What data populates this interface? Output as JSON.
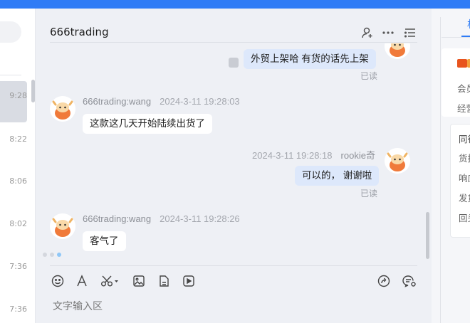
{
  "chat": {
    "title": "666trading",
    "header_icons": [
      "add-user-icon",
      "more-icon",
      "list-icon"
    ],
    "messages": [
      {
        "side": "out",
        "text": "外贸上架哈  有货的话先上架",
        "status": "已读"
      },
      {
        "side": "in",
        "sender": "666trading:wang",
        "time": "2024-3-11 19:28:03",
        "text": "这款这几天开始陆续出货了"
      },
      {
        "side": "out",
        "sender": "rookie奇",
        "time": "2024-3-11 19:28:18",
        "text": "可以的， 谢谢啦",
        "status": "已读"
      },
      {
        "side": "in",
        "sender": "666trading:wang",
        "time": "2024-3-11 19:28:26",
        "text": "客气了"
      }
    ],
    "toolbar_icons": [
      "emoji-icon",
      "font-icon",
      "scissors-icon",
      "image-icon",
      "file-icon",
      "video-icon",
      "share-icon",
      "chat-settings-icon"
    ],
    "input_placeholder": "文字输入区"
  },
  "sidebar": {
    "times": [
      "9:28",
      "8:22",
      "8:06",
      "8:02",
      "7:36",
      "7:36"
    ]
  },
  "right_panel": {
    "tab": "材",
    "items": [
      "会员",
      "经营",
      "同行",
      "货指",
      "响应",
      "发货",
      "回头"
    ]
  },
  "colors": {
    "accent": "#2f7cf6",
    "bubble_out": "#dde8fb",
    "bubble_in": "#ffffff"
  }
}
